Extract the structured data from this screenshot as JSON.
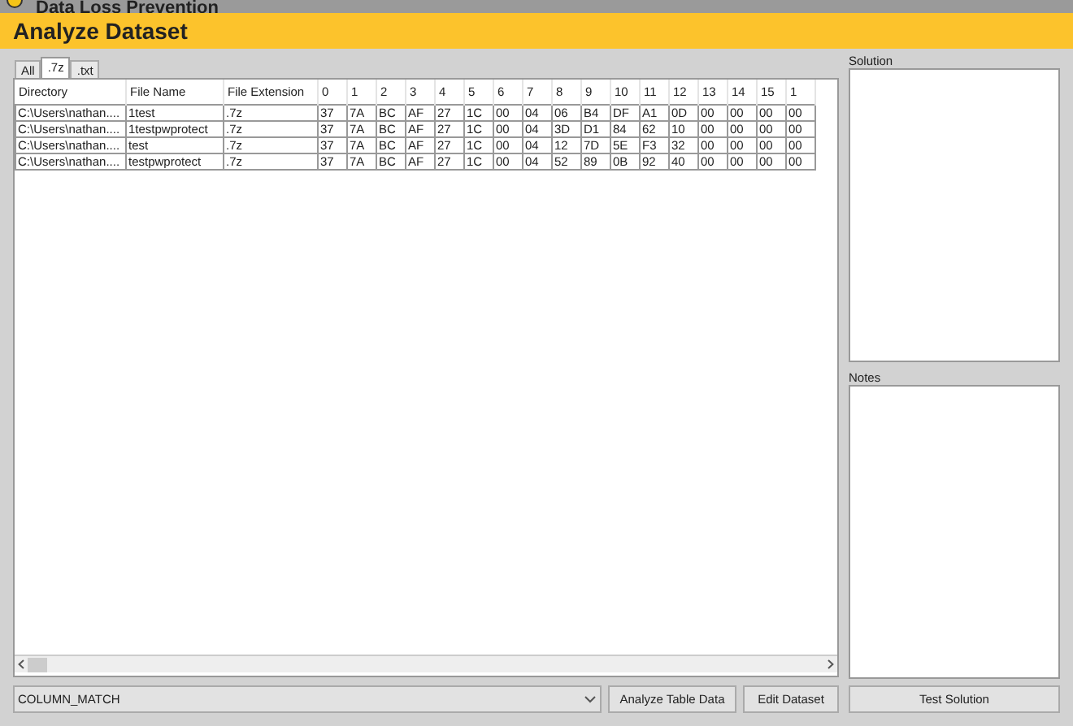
{
  "window": {
    "title": "Data Loss Prevention"
  },
  "header": {
    "title": "Analyze Dataset"
  },
  "tabs": [
    {
      "label": "All",
      "selected": false
    },
    {
      "label": ".7z",
      "selected": true
    },
    {
      "label": ".txt",
      "selected": false
    }
  ],
  "table": {
    "columns": [
      "Directory",
      "File Name",
      "File Extension",
      "0",
      "1",
      "2",
      "3",
      "4",
      "5",
      "6",
      "7",
      "8",
      "9",
      "10",
      "11",
      "12",
      "13",
      "14",
      "15",
      "1"
    ],
    "rows": [
      [
        "C:\\Users\\nathan....",
        "1test",
        ".7z",
        "37",
        "7A",
        "BC",
        "AF",
        "27",
        "1C",
        "00",
        "04",
        "06",
        "B4",
        "DF",
        "A1",
        "0D",
        "00",
        "00",
        "00",
        "00"
      ],
      [
        "C:\\Users\\nathan....",
        "1testpwprotect",
        ".7z",
        "37",
        "7A",
        "BC",
        "AF",
        "27",
        "1C",
        "00",
        "04",
        "3D",
        "D1",
        "84",
        "62",
        "10",
        "00",
        "00",
        "00",
        "00"
      ],
      [
        "C:\\Users\\nathan....",
        "test",
        ".7z",
        "37",
        "7A",
        "BC",
        "AF",
        "27",
        "1C",
        "00",
        "04",
        "12",
        "7D",
        "5E",
        "F3",
        "32",
        "00",
        "00",
        "00",
        "00"
      ],
      [
        "C:\\Users\\nathan....",
        "testpwprotect",
        ".7z",
        "37",
        "7A",
        "BC",
        "AF",
        "27",
        "1C",
        "00",
        "04",
        "52",
        "89",
        "0B",
        "92",
        "40",
        "00",
        "00",
        "00",
        "00"
      ]
    ]
  },
  "solution": {
    "label": "Solution"
  },
  "notes": {
    "label": "Notes"
  },
  "mode_select": {
    "value": "COLUMN_MATCH"
  },
  "buttons": [
    "Analyze Table Data",
    "Edit Dataset",
    "Test Solution"
  ]
}
